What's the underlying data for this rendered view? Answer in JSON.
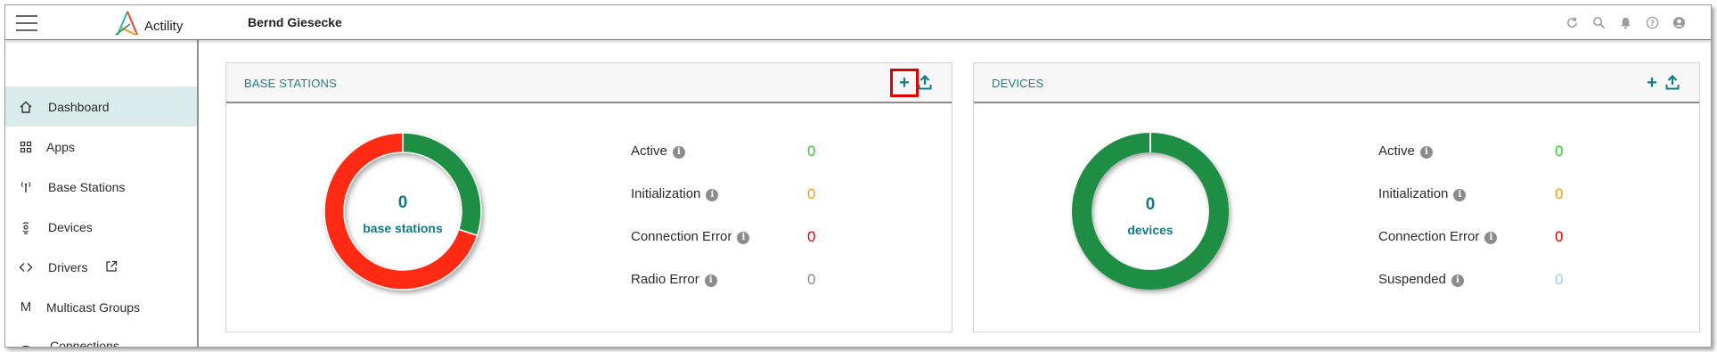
{
  "app": {
    "brand": "Actility",
    "user_name": "Bernd Giesecke"
  },
  "topbar": {
    "icons": [
      "refresh-icon",
      "search-icon",
      "bell-icon",
      "help-icon",
      "account-icon"
    ]
  },
  "sidebar": {
    "items": [
      {
        "label": "Dashboard",
        "icon": "home-icon",
        "active": true
      },
      {
        "label": "Apps",
        "icon": "apps-grid-icon",
        "active": false
      },
      {
        "label": "Base Stations",
        "icon": "antenna-icon",
        "active": false
      },
      {
        "label": "Devices",
        "icon": "device-icon",
        "active": false
      },
      {
        "label": "Drivers",
        "icon": "code-icon",
        "active": false
      },
      {
        "label": "Multicast Groups",
        "icon": "multicast-icon",
        "active": false
      },
      {
        "label": "Connections",
        "icon": "connections-icon",
        "active": false
      }
    ]
  },
  "base_stations": {
    "title": "BASE STATIONS",
    "count": "0",
    "count_label": "base stations",
    "stats": [
      {
        "label": "Active",
        "value": "0",
        "color": "#2ecc2e"
      },
      {
        "label": "Initialization",
        "value": "0",
        "color": "#f39c12"
      },
      {
        "label": "Connection Error",
        "value": "0",
        "color": "#e60000"
      },
      {
        "label": "Radio Error",
        "value": "0",
        "color": "#888888"
      }
    ]
  },
  "devices": {
    "title": "DEVICES",
    "count": "0",
    "count_label": "devices",
    "stats": [
      {
        "label": "Active",
        "value": "0",
        "color": "#2ecc2e"
      },
      {
        "label": "Initialization",
        "value": "0",
        "color": "#f39c12"
      },
      {
        "label": "Connection Error",
        "value": "0",
        "color": "#e60000"
      },
      {
        "label": "Suspended",
        "value": "0",
        "color": "#9ecbf0"
      }
    ]
  },
  "chart_data": [
    {
      "type": "pie",
      "title": "",
      "categories": [
        "green segment",
        "red segment"
      ],
      "values": [
        0.3,
        0.7
      ],
      "colors": [
        "#1e8e45",
        "#ff2a14"
      ],
      "center_value": "0",
      "center_label": "base stations"
    },
    {
      "type": "pie",
      "title": "",
      "categories": [
        "green segment"
      ],
      "values": [
        1.0
      ],
      "colors": [
        "#1e8e45"
      ],
      "center_value": "0",
      "center_label": "devices"
    }
  ]
}
